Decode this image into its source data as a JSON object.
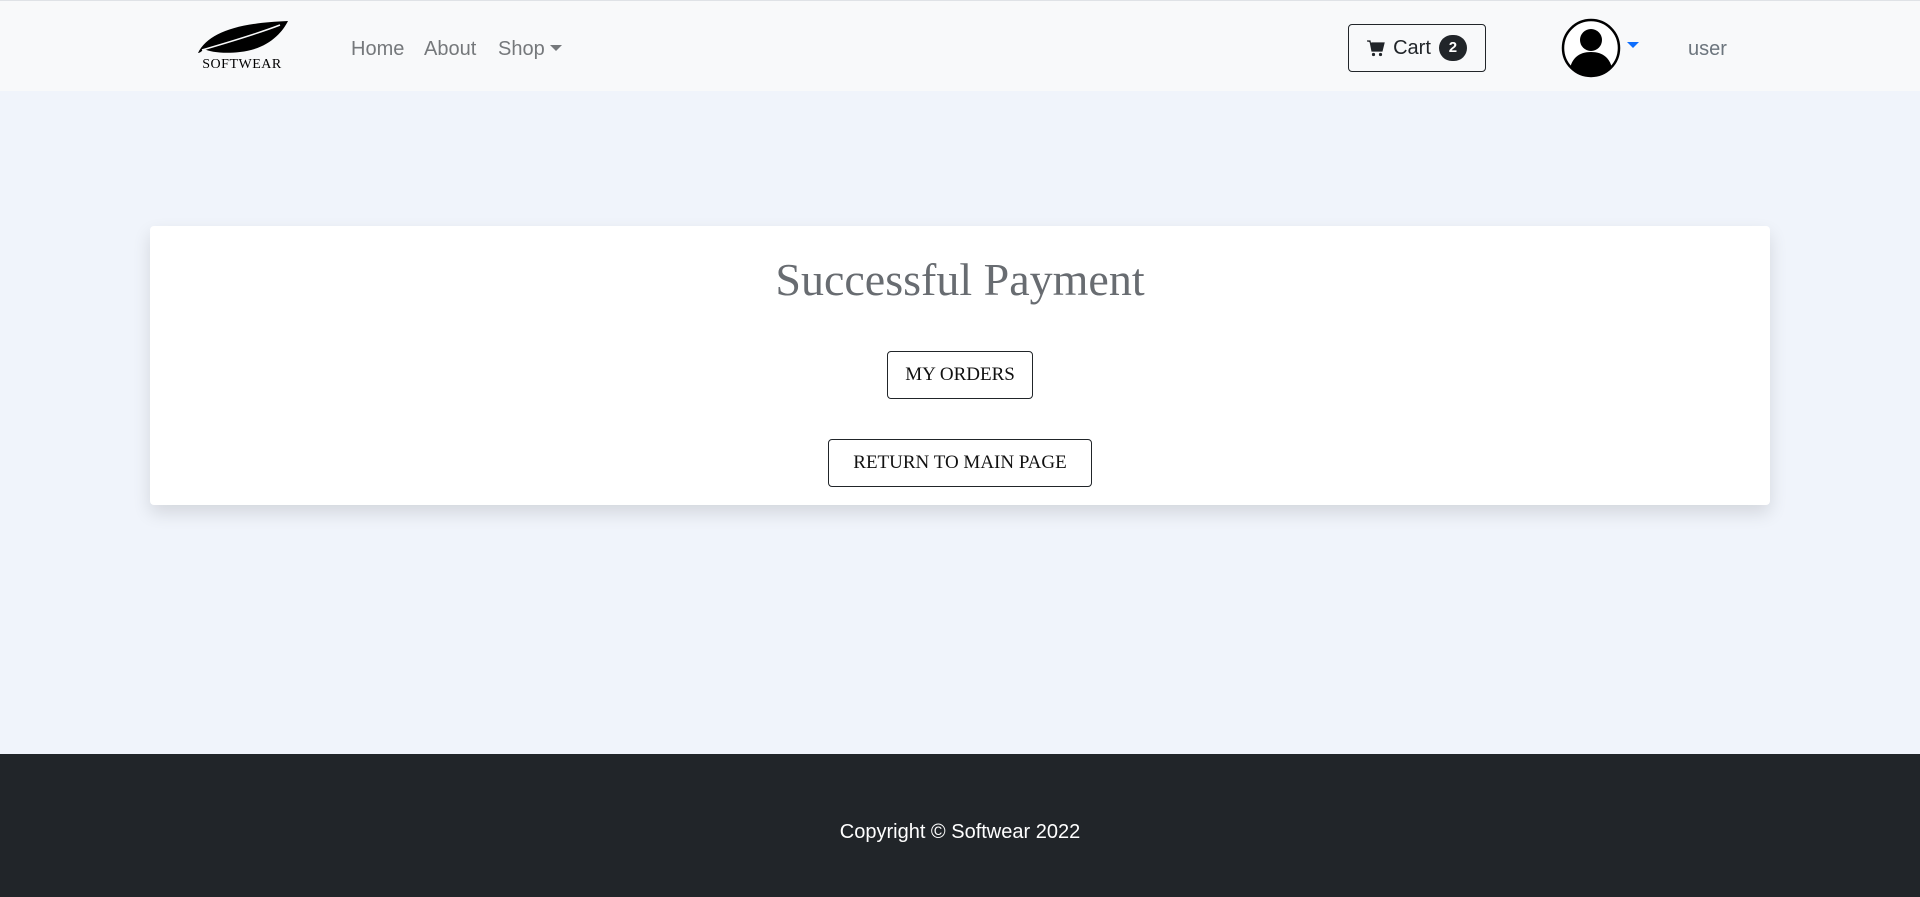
{
  "navbar": {
    "brand": "SOFTWEAR",
    "links": {
      "home": "Home",
      "about": "About",
      "shop": "Shop"
    },
    "cart": {
      "label": "Cart",
      "count": "2"
    },
    "user": {
      "name": "user"
    }
  },
  "main": {
    "title": "Successful Payment",
    "my_orders_label": "MY ORDERS",
    "return_label": "RETURN TO MAIN PAGE"
  },
  "footer": {
    "copyright": "Copyright © Softwear 2022"
  },
  "colors": {
    "page_bg": "#f0f4fb",
    "navbar_bg": "#f8f9fa",
    "footer_bg": "#212529",
    "accent": "#0d6efd"
  },
  "icons": [
    "leaf-logo-icon",
    "cart-icon",
    "user-avatar-icon",
    "chevron-down-icon"
  ]
}
